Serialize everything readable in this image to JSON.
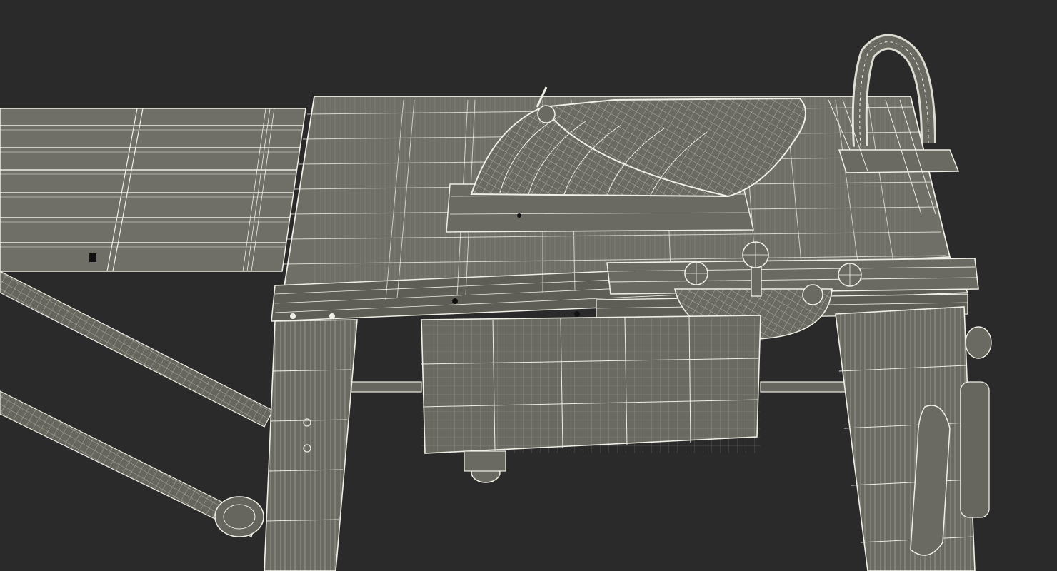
{
  "scene": {
    "background_color": "#2a2a2a",
    "surface_color": "#6f6f67",
    "surface_dark_color": "#5e5e57",
    "wire_color": "#f0efe6"
  }
}
